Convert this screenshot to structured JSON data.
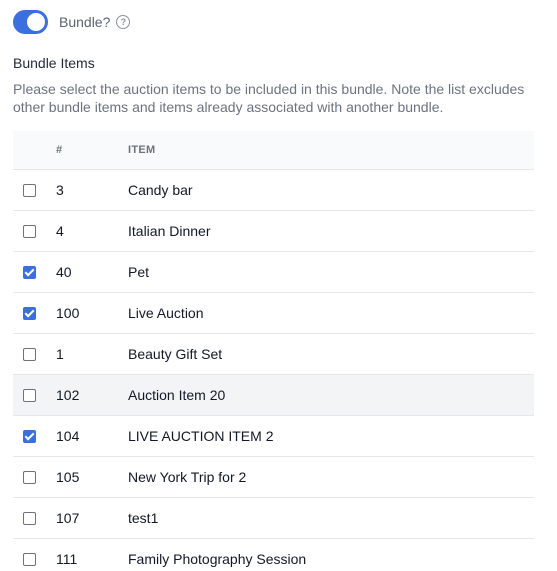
{
  "toggle": {
    "label": "Bundle?",
    "on": true,
    "help_icon": "?"
  },
  "section": {
    "title": "Bundle Items",
    "description": "Please select the auction items to be included in this bundle. Note the list excludes other bundle items and items already associated with another bundle."
  },
  "table": {
    "headers": {
      "num": "#",
      "item": "ITEM"
    },
    "rows": [
      {
        "num": "3",
        "item": "Candy bar",
        "checked": false
      },
      {
        "num": "4",
        "item": "Italian Dinner",
        "checked": false
      },
      {
        "num": "40",
        "item": "Pet",
        "checked": true
      },
      {
        "num": "100",
        "item": "Live Auction",
        "checked": true
      },
      {
        "num": "1",
        "item": "Beauty Gift Set",
        "checked": false
      },
      {
        "num": "102",
        "item": "Auction Item 20",
        "checked": false,
        "hover": true
      },
      {
        "num": "104",
        "item": "LIVE AUCTION ITEM 2",
        "checked": true
      },
      {
        "num": "105",
        "item": "New York Trip for 2",
        "checked": false
      },
      {
        "num": "107",
        "item": "test1",
        "checked": false
      },
      {
        "num": "111",
        "item": "Family Photography Session",
        "checked": false
      }
    ]
  },
  "colors": {
    "accent": "#3b6fe0"
  }
}
